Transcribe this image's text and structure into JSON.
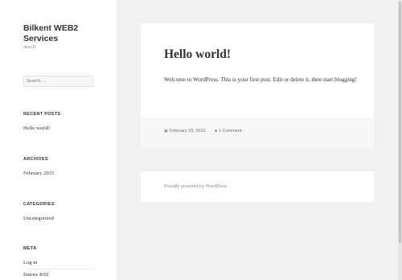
{
  "site": {
    "title": "Bilkent WEB2 Services",
    "description": "desc2/"
  },
  "search": {
    "placeholder": "Search …"
  },
  "widgets": {
    "recent_posts": {
      "title": "RECENT POSTS",
      "items": [
        "Hello world!"
      ]
    },
    "archives": {
      "title": "ARCHIVES",
      "items": [
        "February 2015"
      ]
    },
    "categories": {
      "title": "CATEGORIES",
      "items": [
        "Uncategorized"
      ]
    },
    "meta": {
      "title": "META",
      "items": [
        "Log in",
        "Entries RSS"
      ]
    }
  },
  "post": {
    "title": "Hello world!",
    "content": "Welcome to WordPress. This is your first post. Edit or delete it, then start blogging!",
    "date": "February 25, 2015",
    "comments": "1 Comment",
    "date_icon": "calendar-icon",
    "comment_icon": "comment-icon"
  },
  "footer": {
    "text": "Proudly powered by WordPress"
  }
}
